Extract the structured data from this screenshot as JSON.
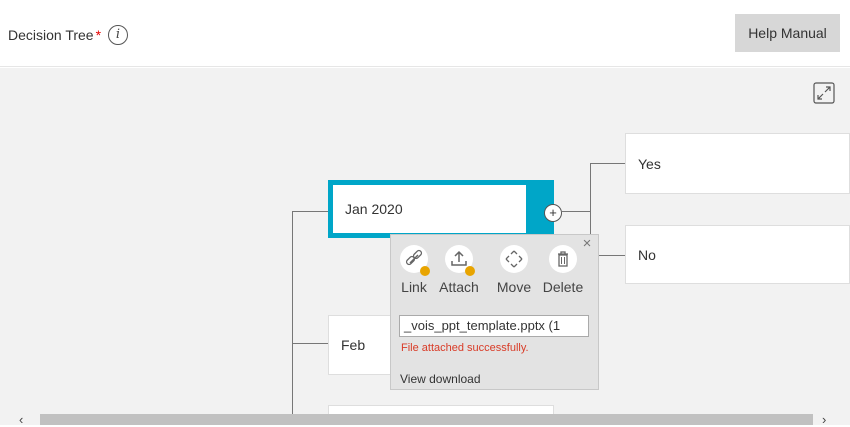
{
  "header": {
    "title": "Decision Tree",
    "required_mark": "*",
    "info_glyph": "i",
    "help_button": "Help Manual"
  },
  "tree": {
    "selected_node": "Jan 2020",
    "node_feb": "Feb",
    "node_yes": "Yes",
    "node_no": "No",
    "add_glyph": "+"
  },
  "popup": {
    "close_glyph": "×",
    "actions": [
      {
        "label": "Link",
        "icon": "link-icon",
        "has_badge": true
      },
      {
        "label": "Attach",
        "icon": "upload-icon",
        "has_badge": true
      },
      {
        "label": "Move",
        "icon": "move-icon",
        "has_badge": false
      },
      {
        "label": "Delete",
        "icon": "trash-icon",
        "has_badge": false
      }
    ],
    "file_value": "_vois_ppt_template.pptx (1",
    "status_message": "File attached successfully.",
    "view_download": "View download"
  },
  "scrollbar": {
    "left_arrow": "‹",
    "right_arrow": "›"
  },
  "colors": {
    "selected_border": "#00a6c8",
    "badge": "#e8a400",
    "success_text": "#d93b27",
    "required": "#e60000"
  }
}
